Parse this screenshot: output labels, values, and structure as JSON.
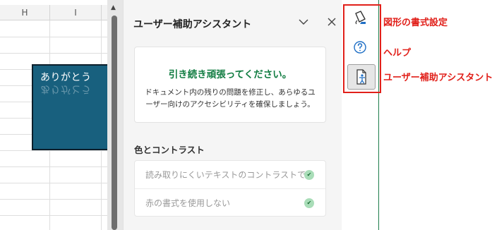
{
  "sheet": {
    "columns": [
      "H",
      "I"
    ],
    "shape_text": "ありがとう"
  },
  "pane": {
    "title": "ユーザー補助アシスタント",
    "card": {
      "heading": "引き続き頑張ってください。",
      "body": "ドキュメント内の残りの問題を修正し、あらゆるユーザー向けのアクセシビリティを確保しましょう。"
    },
    "section_title": "色とコントラスト",
    "checks": [
      {
        "label": "読み取りにくいテキストのコントラストです",
        "status": "ok"
      },
      {
        "label": "赤の書式を使用しない",
        "status": "ok"
      }
    ]
  },
  "icons": {
    "format_shape": "format-shape-icon",
    "help": "help-icon",
    "accessibility": "accessibility-icon",
    "chevron": "chevron-down-icon",
    "close": "close-icon",
    "check": "check-icon"
  },
  "annotations": {
    "format_shape": "図形の書式設定",
    "help": "ヘルプ",
    "accessibility": "ユーザー補助アシスタント"
  },
  "colors": {
    "shape_fill": "#18607e",
    "success_green": "#107c41",
    "annotation_red": "#e1201a",
    "check_badge": "#a9ddb8"
  }
}
